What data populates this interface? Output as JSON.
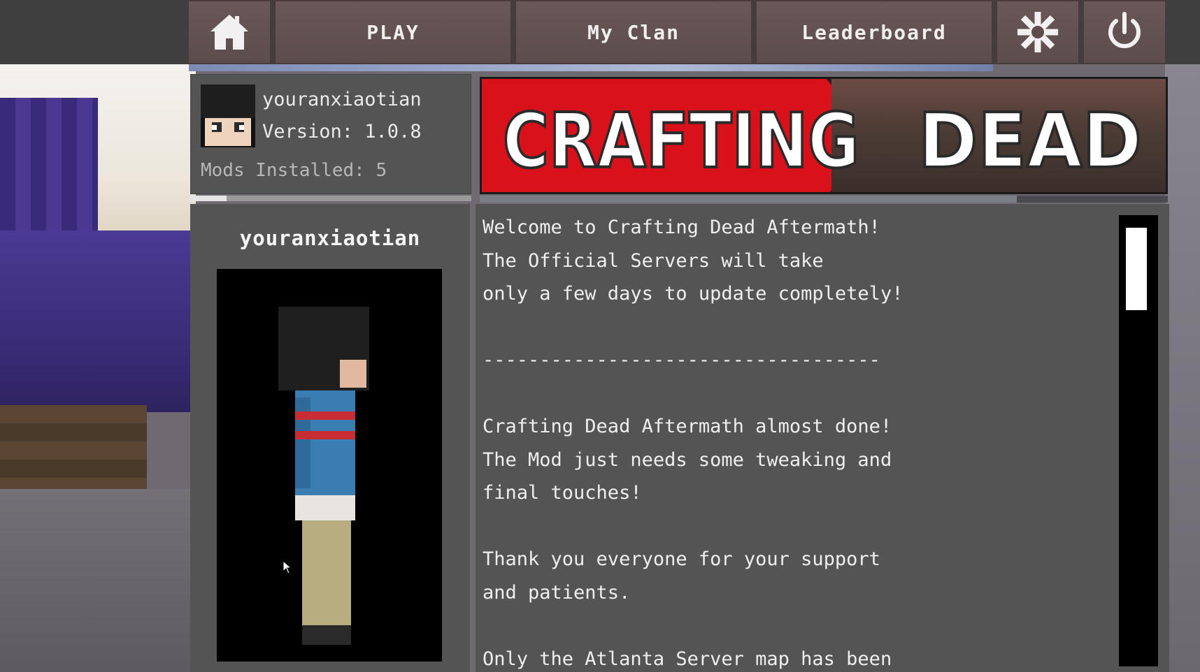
{
  "nav": {
    "home_icon": "home-icon",
    "play_label": "PLAY",
    "clan_label": "My Clan",
    "leaderboard_label": "Leaderboard",
    "settings_icon": "gear-icon",
    "power_icon": "power-icon"
  },
  "profile": {
    "username": "youranxiaotian",
    "version": "Version: 1.0.8",
    "mods_installed": "Mods Installed: 5",
    "loading_fraction": 0.13
  },
  "skin": {
    "title": "youranxiaotian"
  },
  "banner": {
    "logo_text_1": "CRAFTING",
    "logo_text_2": "DEAD",
    "loading_fraction": 0.78
  },
  "news": {
    "lines": [
      "Welcome to Crafting Dead Aftermath!",
      "The Official Servers will take",
      "only a few days to update completely!",
      "",
      "-----------------------------------",
      "",
      "Crafting Dead Aftermath almost done!",
      "The Mod just needs some tweaking and",
      "final touches!",
      "",
      "Thank you everyone for your support",
      "and patients.",
      "",
      "Only the Atlanta Server map has been"
    ]
  },
  "colors": {
    "button_bg": "#5d4c4c",
    "panel_bg": "#545454",
    "banner_red": "#d8111b"
  }
}
